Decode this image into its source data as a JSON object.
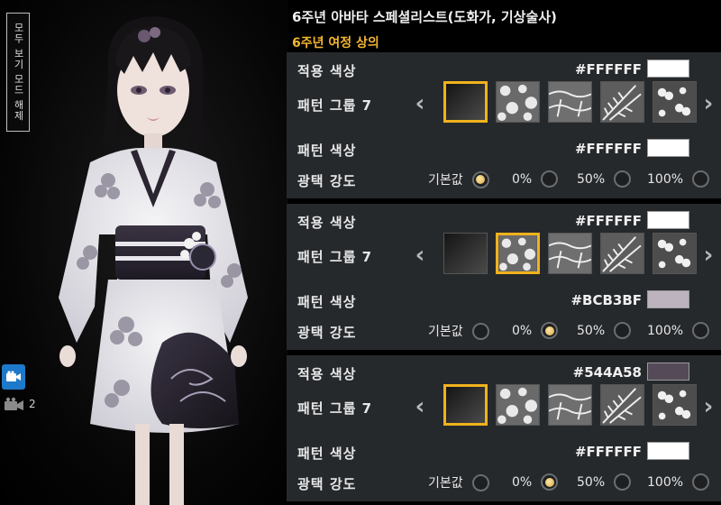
{
  "header": {
    "title": "6주년 아바타 스페셜리스트(도화가, 기상술사)",
    "subtitle": "6주년 여정 상의"
  },
  "side": {
    "vertical_label": "모두 보기 모드 해제",
    "camera_count": "2"
  },
  "labels": {
    "apply_color": "적용 색상",
    "pattern_group": "패턴 그룹 7",
    "pattern_color": "패턴 색상",
    "gloss": "광택 강도"
  },
  "gloss_options": [
    "기본값",
    "0%",
    "50%",
    "100%"
  ],
  "panels": [
    {
      "apply_color": "#FFFFFF",
      "apply_color_swatch": "#FFFFFF",
      "pattern_color": "#FFFFFF",
      "pattern_color_swatch": "#FFFFFF",
      "selected_pattern_index": 0,
      "selected_gloss_index": 0
    },
    {
      "apply_color": "#FFFFFF",
      "apply_color_swatch": "#FFFFFF",
      "pattern_color": "#BCB3BF",
      "pattern_color_swatch": "#BCB3BF",
      "selected_pattern_index": 1,
      "selected_gloss_index": 1
    },
    {
      "apply_color": "#544A58",
      "apply_color_swatch": "#544A58",
      "pattern_color": "#FFFFFF",
      "pattern_color_swatch": "#FFFFFF",
      "selected_pattern_index": 0,
      "selected_gloss_index": 1
    }
  ],
  "patterns": [
    "solid-pattern-icon",
    "hibiscus-pattern-icon",
    "tropical-island-pattern-icon",
    "palm-leaf-pattern-icon",
    "cherry-pattern-icon"
  ],
  "colors": {
    "accent_gold": "#F0B21C",
    "subtitle_orange": "#F3B630",
    "panel_bg": "#26292C"
  }
}
